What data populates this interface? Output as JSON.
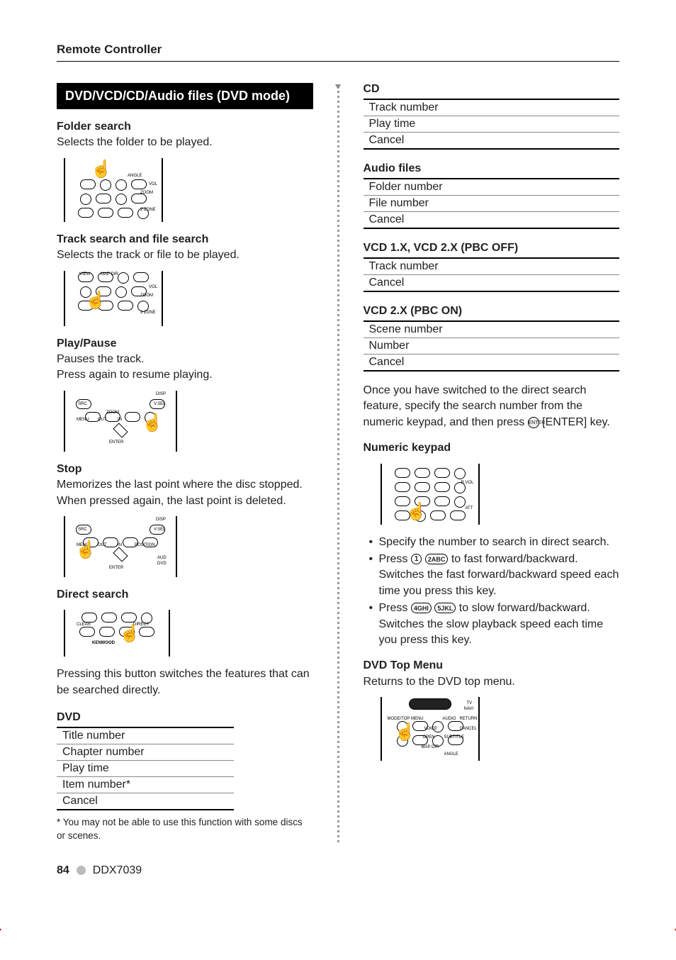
{
  "header": {
    "title": "Remote Controller"
  },
  "left": {
    "section_title": "DVD/VCD/CD/Audio files (DVD mode)",
    "folder": {
      "title": "Folder search",
      "desc": "Selects the folder to be played."
    },
    "track": {
      "title": "Track search and file search",
      "desc": "Selects the track or file to be played."
    },
    "play": {
      "title": "Play/Pause",
      "line1": "Pauses the track.",
      "line2": "Press again to resume playing."
    },
    "stop": {
      "title": "Stop",
      "desc": "Memorizes the last point where the disc stopped. When pressed again, the last point is deleted."
    },
    "direct": {
      "title": "Direct search",
      "desc": "Pressing this button switches the features that can be searched directly."
    },
    "dvd": {
      "title": "DVD",
      "rows": [
        "Title number",
        "Chapter number",
        "Play time",
        "Item number*",
        "Cancel"
      ]
    },
    "footnote": "* You may not be able to use this function with some discs or scenes."
  },
  "right": {
    "cd": {
      "title": "CD",
      "rows": [
        "Track number",
        "Play time",
        "Cancel"
      ]
    },
    "audio": {
      "title": "Audio files",
      "rows": [
        "Folder number",
        "File number",
        "Cancel"
      ]
    },
    "vcd_off": {
      "title": "VCD 1.X, VCD 2.X (PBC OFF)",
      "rows": [
        "Track number",
        "Cancel"
      ]
    },
    "vcd_on": {
      "title": "VCD 2.X (PBC ON)",
      "rows": [
        "Scene number",
        "Number",
        "Cancel"
      ]
    },
    "direct_note": {
      "text_pre": "Once you have switched to the direct search feature, specify the search number from the numeric keypad, and then press ",
      "enter_label": "ENTER",
      "text_post": " [ENTER] key."
    },
    "numkey": {
      "title": "Numeric keypad"
    },
    "bullets": {
      "b1": "Specify the number to search in direct search.",
      "b2_pre": "Press ",
      "key1": "1",
      "key2": "2ABC",
      "b2_post": " to fast forward/backward. Switches the fast forward/backward speed each time you press this key.",
      "b3_pre": "Press ",
      "key4": "4GHI",
      "key5": "5JKL",
      "b3_post": " to slow forward/backward. Switches the slow playback speed each time you press this key."
    },
    "topmenu": {
      "title": "DVD Top Menu",
      "desc": "Returns to the DVD top menu."
    }
  },
  "footer": {
    "page": "84",
    "model": "DDX7039"
  }
}
